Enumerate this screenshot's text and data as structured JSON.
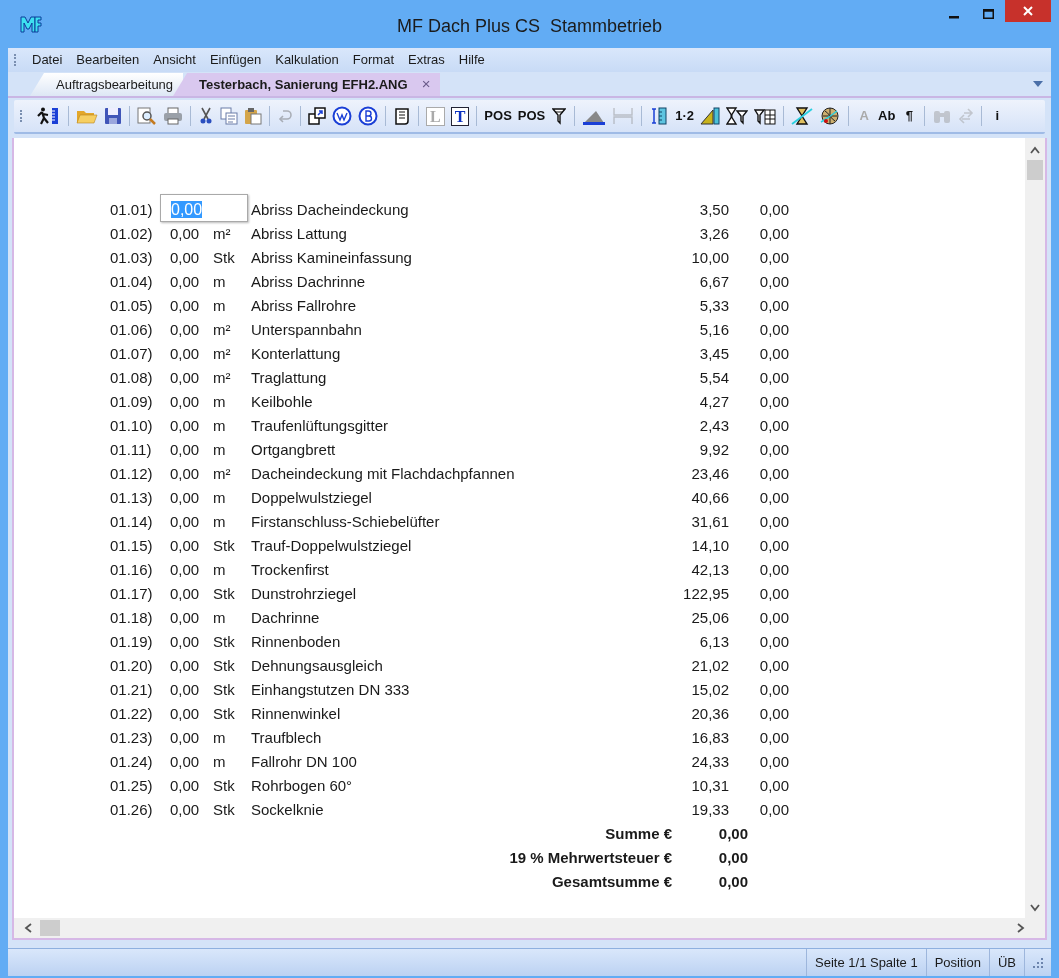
{
  "window": {
    "title": "MF Dach Plus CS  Stammbetrieb"
  },
  "menu": [
    {
      "label": "Datei"
    },
    {
      "label": "Bearbeiten"
    },
    {
      "label": "Ansicht"
    },
    {
      "label": "Einfügen"
    },
    {
      "label": "Kalkulation"
    },
    {
      "label": "Format"
    },
    {
      "label": "Extras"
    },
    {
      "label": "Hilfe"
    }
  ],
  "tabs": [
    {
      "label": "Auftragsbearbeitung",
      "selected": false
    },
    {
      "label": "Testerbach, Sanierung EFH2.ANG",
      "selected": true,
      "close": "×"
    }
  ],
  "toolbar": [
    {
      "kind": "icon",
      "disabled": false
    },
    {
      "kind": "separator"
    },
    {
      "kind": "icon",
      "disabled": false
    },
    {
      "kind": "icon",
      "disabled": false
    },
    {
      "kind": "separator"
    },
    {
      "kind": "icon",
      "disabled": false
    },
    {
      "kind": "icon",
      "disabled": false
    },
    {
      "kind": "separator"
    },
    {
      "kind": "icon",
      "disabled": false
    },
    {
      "kind": "icon",
      "disabled": false
    },
    {
      "kind": "icon",
      "disabled": false
    },
    {
      "kind": "separator"
    },
    {
      "kind": "icon",
      "disabled": true
    },
    {
      "kind": "separator"
    },
    {
      "kind": "icon",
      "disabled": false
    },
    {
      "kind": "icon",
      "disabled": false
    },
    {
      "kind": "icon",
      "disabled": false
    },
    {
      "kind": "separator"
    },
    {
      "kind": "icon",
      "disabled": false
    },
    {
      "kind": "separator"
    },
    {
      "kind": "boxed",
      "label": "L",
      "disabled": true
    },
    {
      "kind": "boxed",
      "label": "T",
      "disabled": false
    },
    {
      "kind": "separator"
    },
    {
      "kind": "glyph",
      "label": "POS",
      "disabled": false
    },
    {
      "kind": "glyph",
      "label": "POS",
      "disabled": false
    },
    {
      "kind": "icon",
      "disabled": false
    },
    {
      "kind": "separator"
    },
    {
      "kind": "icon",
      "disabled": false
    },
    {
      "kind": "icon",
      "disabled": true
    },
    {
      "kind": "separator"
    },
    {
      "kind": "icon",
      "disabled": false
    },
    {
      "kind": "glyph",
      "label": "1·2",
      "disabled": false
    },
    {
      "kind": "icon",
      "disabled": false
    },
    {
      "kind": "icon",
      "disabled": false
    },
    {
      "kind": "icon",
      "disabled": false
    },
    {
      "kind": "separator"
    },
    {
      "kind": "icon",
      "disabled": false
    },
    {
      "kind": "icon",
      "disabled": false
    },
    {
      "kind": "separator"
    },
    {
      "kind": "glyph",
      "label": "A",
      "disabled": true
    },
    {
      "kind": "glyph",
      "label": "Ab",
      "disabled": false
    },
    {
      "kind": "glyph",
      "label": "¶",
      "disabled": false
    },
    {
      "kind": "separator"
    },
    {
      "kind": "icon",
      "disabled": true
    },
    {
      "kind": "icon",
      "disabled": true
    },
    {
      "kind": "separator"
    },
    {
      "kind": "glyph",
      "label": "i",
      "disabled": false
    }
  ],
  "rows": [
    {
      "pos": "01.01)",
      "qty": "0,00",
      "editing": true,
      "desc": "Abriss Dacheindeckung",
      "price": "3,50",
      "total": "0,00"
    },
    {
      "pos": "01.02)",
      "qty": "0,00",
      "unit": "m²",
      "editing": false,
      "desc": "Abriss Lattung",
      "price": "3,26",
      "total": "0,00"
    },
    {
      "pos": "01.03)",
      "qty": "0,00",
      "unit": "Stk",
      "editing": false,
      "desc": "Abriss Kamineinfassung",
      "price": "10,00",
      "total": "0,00"
    },
    {
      "pos": "01.04)",
      "qty": "0,00",
      "unit": "m",
      "editing": false,
      "desc": "Abriss Dachrinne",
      "price": "6,67",
      "total": "0,00"
    },
    {
      "pos": "01.05)",
      "qty": "0,00",
      "unit": "m",
      "editing": false,
      "desc": "Abriss Fallrohre",
      "price": "5,33",
      "total": "0,00"
    },
    {
      "pos": "01.06)",
      "qty": "0,00",
      "unit": "m²",
      "editing": false,
      "desc": "Unterspannbahn",
      "price": "5,16",
      "total": "0,00"
    },
    {
      "pos": "01.07)",
      "qty": "0,00",
      "unit": "m²",
      "editing": false,
      "desc": "Konterlattung",
      "price": "3,45",
      "total": "0,00"
    },
    {
      "pos": "01.08)",
      "qty": "0,00",
      "unit": "m²",
      "editing": false,
      "desc": "Traglattung",
      "price": "5,54",
      "total": "0,00"
    },
    {
      "pos": "01.09)",
      "qty": "0,00",
      "unit": "m",
      "editing": false,
      "desc": "Keilbohle",
      "price": "4,27",
      "total": "0,00"
    },
    {
      "pos": "01.10)",
      "qty": "0,00",
      "unit": "m",
      "editing": false,
      "desc": "Traufenlüftungsgitter",
      "price": "2,43",
      "total": "0,00"
    },
    {
      "pos": "01.11)",
      "qty": "0,00",
      "unit": "m",
      "editing": false,
      "desc": "Ortgangbrett",
      "price": "9,92",
      "total": "0,00"
    },
    {
      "pos": "01.12)",
      "qty": "0,00",
      "unit": "m²",
      "editing": false,
      "desc": "Dacheindeckung mit Flachdachpfannen",
      "price": "23,46",
      "total": "0,00"
    },
    {
      "pos": "01.13)",
      "qty": "0,00",
      "unit": "m",
      "editing": false,
      "desc": "Doppelwulstziegel",
      "price": "40,66",
      "total": "0,00"
    },
    {
      "pos": "01.14)",
      "qty": "0,00",
      "unit": "m",
      "editing": false,
      "desc": "Firstanschluss-Schiebelüfter",
      "price": "31,61",
      "total": "0,00"
    },
    {
      "pos": "01.15)",
      "qty": "0,00",
      "unit": "Stk",
      "editing": false,
      "desc": "Trauf-Doppelwulstziegel",
      "price": "14,10",
      "total": "0,00"
    },
    {
      "pos": "01.16)",
      "qty": "0,00",
      "unit": "m",
      "editing": false,
      "desc": "Trockenfirst",
      "price": "42,13",
      "total": "0,00"
    },
    {
      "pos": "01.17)",
      "qty": "0,00",
      "unit": "Stk",
      "editing": false,
      "desc": "Dunstrohrziegel",
      "price": "122,95",
      "total": "0,00"
    },
    {
      "pos": "01.18)",
      "qty": "0,00",
      "unit": "m",
      "editing": false,
      "desc": "Dachrinne",
      "price": "25,06",
      "total": "0,00"
    },
    {
      "pos": "01.19)",
      "qty": "0,00",
      "unit": "Stk",
      "editing": false,
      "desc": "Rinnenboden",
      "price": "6,13",
      "total": "0,00"
    },
    {
      "pos": "01.20)",
      "qty": "0,00",
      "unit": "Stk",
      "editing": false,
      "desc": "Dehnungsausgleich",
      "price": "21,02",
      "total": "0,00"
    },
    {
      "pos": "01.21)",
      "qty": "0,00",
      "unit": "Stk",
      "editing": false,
      "desc": "Einhangstutzen DN 333",
      "price": "15,02",
      "total": "0,00"
    },
    {
      "pos": "01.22)",
      "qty": "0,00",
      "unit": "Stk",
      "editing": false,
      "desc": "Rinnenwinkel",
      "price": "20,36",
      "total": "0,00"
    },
    {
      "pos": "01.23)",
      "qty": "0,00",
      "unit": "m",
      "editing": false,
      "desc": "Traufblech",
      "price": "16,83",
      "total": "0,00"
    },
    {
      "pos": "01.24)",
      "qty": "0,00",
      "unit": "m",
      "editing": false,
      "desc": "Fallrohr DN 100",
      "price": "24,33",
      "total": "0,00"
    },
    {
      "pos": "01.25)",
      "qty": "0,00",
      "unit": "Stk",
      "editing": false,
      "desc": "Rohrbogen 60°",
      "price": "10,31",
      "total": "0,00"
    },
    {
      "pos": "01.26)",
      "qty": "0,00",
      "unit": "Stk",
      "editing": false,
      "desc": "Sockelknie",
      "price": "19,33",
      "total": "0,00"
    }
  ],
  "totals": [
    {
      "label": "Summe €",
      "value": "0,00"
    },
    {
      "label": "19 % Mehrwertsteuer €",
      "value": "0,00"
    },
    {
      "label": "Gesamtsumme €",
      "value": "0,00"
    }
  ],
  "status_bar": [
    "Seite 1/1 Spalte 1",
    "Position",
    "ÜB"
  ]
}
